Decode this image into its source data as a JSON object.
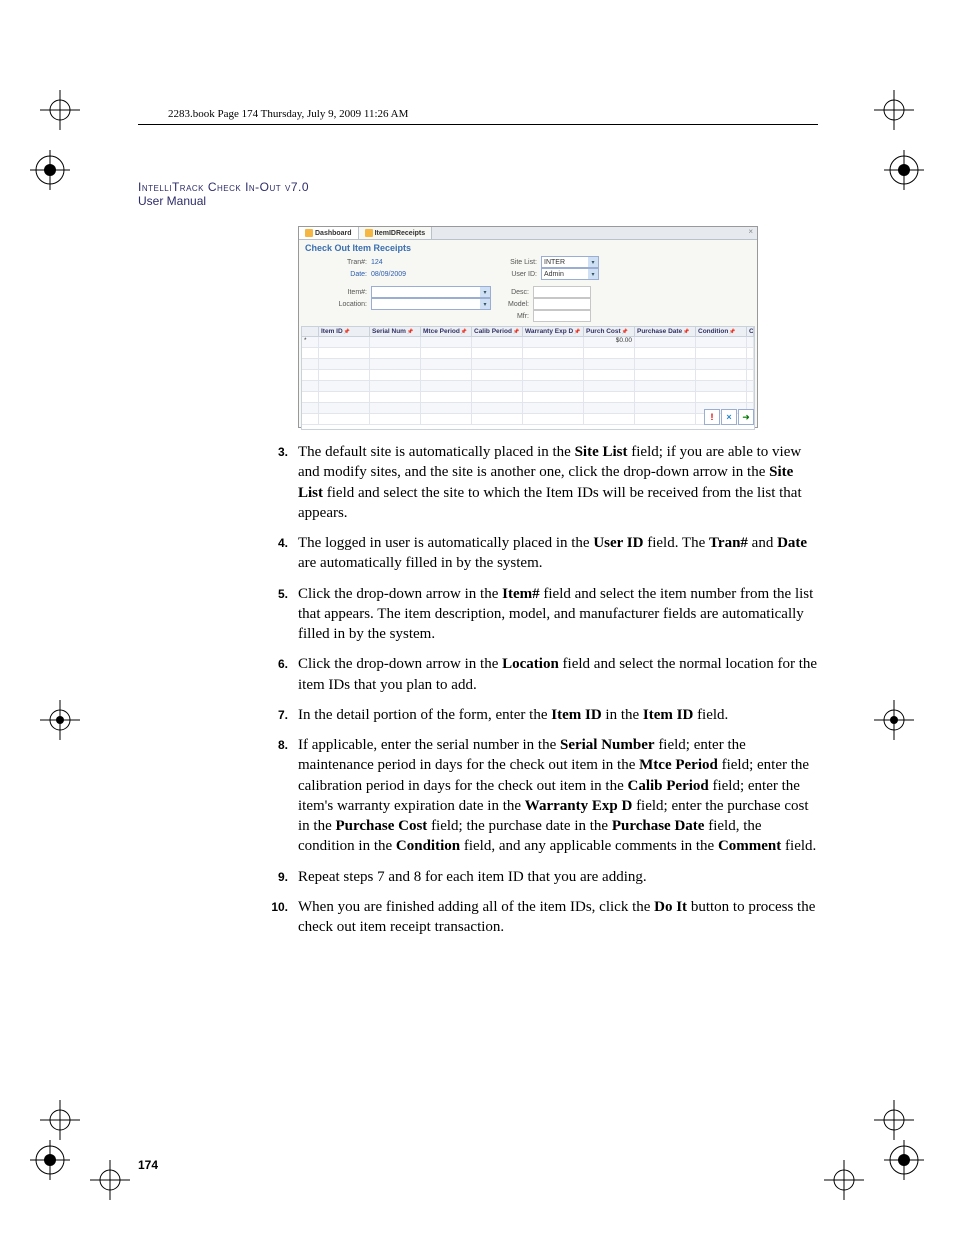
{
  "header_line": "2283.book  Page 174  Thursday, July 9, 2009  11:26 AM",
  "running_head_1": "IntelliTrack Check In-Out v7.0",
  "running_head_2": "User Manual",
  "page_number": "174",
  "app": {
    "tabs": [
      "Dashboard",
      "ItemIDReceipts"
    ],
    "title": "Check Out Item Receipts",
    "fields": {
      "tran_label": "Tran#:",
      "tran_value": "124",
      "date_label": "Date:",
      "date_value": "08/09/2009",
      "item_label": "Item#:",
      "location_label": "Location:",
      "sitelist_label": "Site List:",
      "sitelist_value": "INTER",
      "userid_label": "User ID:",
      "userid_value": "Admin",
      "desc_label": "Desc:",
      "model_label": "Model:",
      "mfr_label": "Mfr:"
    },
    "columns": [
      "Item ID",
      "Serial Num",
      "Mtce Period",
      "Calib Period",
      "Warranty Exp D",
      "Purch Cost",
      "Purchase Date",
      "Condition",
      "Comment"
    ],
    "first_cost": "$0.00",
    "footer_icons": [
      "!",
      "×",
      "➜"
    ]
  },
  "steps": {
    "3": "The default site is automatically placed in the |Site List| field; if you are able to view and modify sites, and the site is another one, click the drop-down arrow in the |Site List| field and select the site to which the Item IDs will be received from the list that appears.",
    "4": "The logged in user is automatically placed in the |User ID| field. The |Tran#| and |Date| are automatically filled in by the system.",
    "5": "Click the drop-down arrow in the |Item#| field and select the item number from the list that appears. The item description, model, and manufacturer fields are automatically filled in by the system.",
    "6": "Click the drop-down arrow in the |Location| field and select the normal location for the item IDs that you plan to add.",
    "7": "In the detail portion of the form, enter the |Item ID| in the |Item ID| field.",
    "8": "If applicable, enter the serial number in the |Serial Number| field; enter the maintenance period in days for the check out item in the |Mtce Period| field; enter the calibration period in days for the check out item in the |Calib Period| field; enter the item's warranty expiration date in the |Warranty Exp D| field; enter the purchase cost in the |Purchase Cost| field; the purchase date in the |Purchase Date| field, the condition in the |Condition| field, and any applicable comments in the |Comment| field.",
    "9": "Repeat steps 7 and 8 for each item ID that you are adding.",
    "10": "When you are finished adding all of the item IDs, click the |Do It| button to process the check out item receipt transaction."
  }
}
